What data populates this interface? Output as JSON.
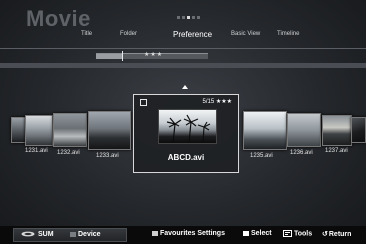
{
  "header": {
    "app_title": "Movie",
    "tabs": [
      {
        "label": "Title"
      },
      {
        "label": "Folder"
      },
      {
        "label": "Preference",
        "active": true
      },
      {
        "label": "Basic View"
      },
      {
        "label": "Timeline"
      }
    ],
    "page_dots_total": 5,
    "page_dots_active": 3
  },
  "progress": {
    "fraction": 0.23,
    "stars": "★★★"
  },
  "files": [
    {
      "name": "1231.avi"
    },
    {
      "name": "1232.avi"
    },
    {
      "name": "1233.avi"
    },
    {
      "name": "1235.avi"
    },
    {
      "name": "1236.avi"
    },
    {
      "name": "1237.avi"
    }
  ],
  "focused": {
    "name": "ABCD.avi",
    "index_label": "5/15 ★★★"
  },
  "footer": {
    "sum_label": "SUM",
    "device_label": "Device",
    "favourites_label": "Favourites Settings",
    "select_label": "Select",
    "tools_label": "Tools",
    "return_label": "Return",
    "colors": {
      "select_square": "#ffffff",
      "favourites_square": "#cfcfcf"
    }
  }
}
